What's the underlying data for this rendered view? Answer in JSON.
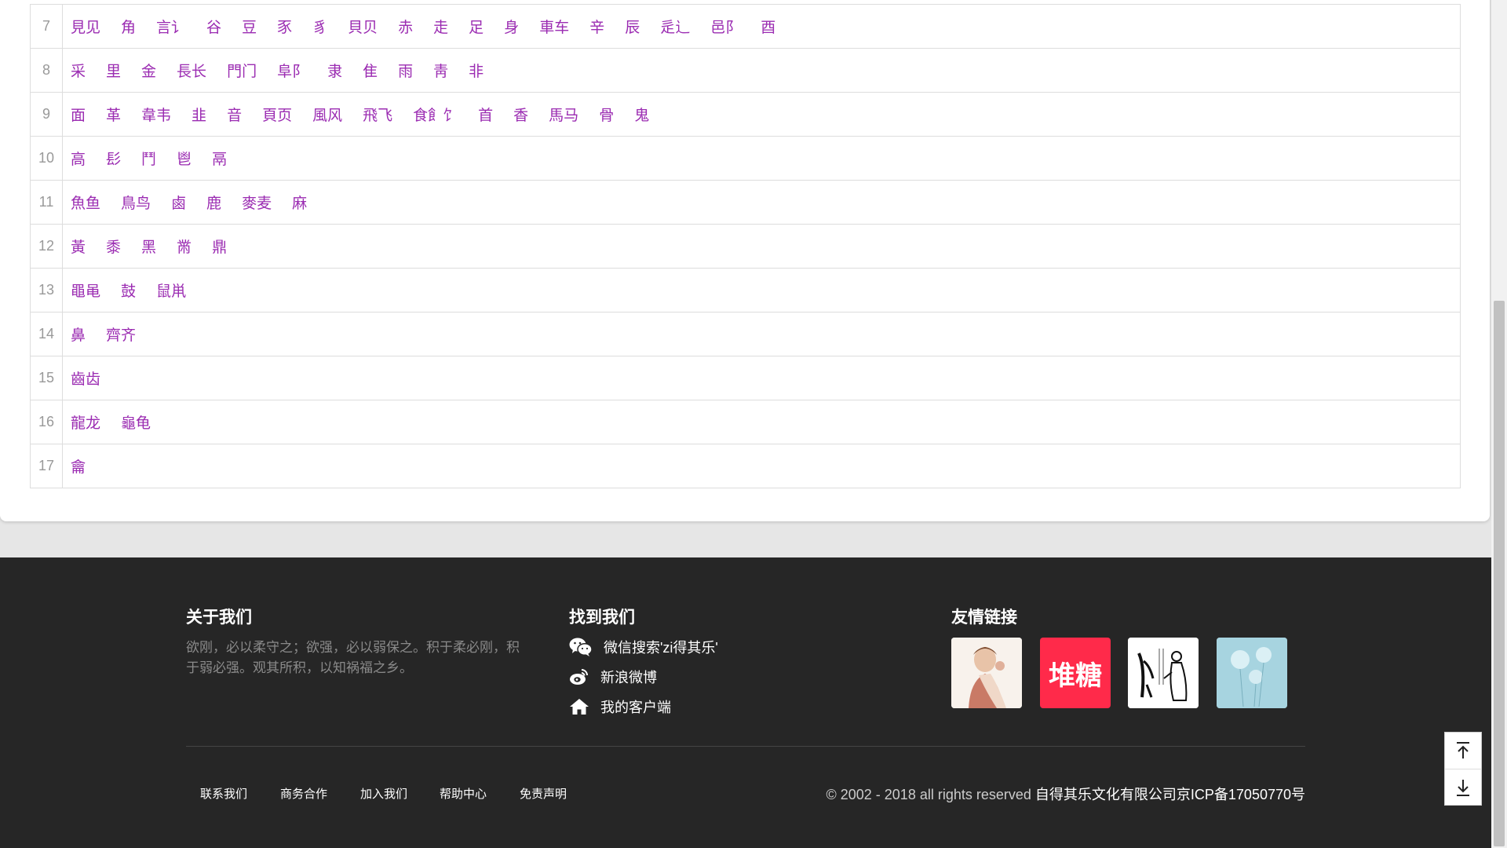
{
  "radicals": [
    {
      "strokes": "7",
      "chars": [
        "見见",
        "角",
        "言讠",
        "谷",
        "豆",
        "豕",
        "豸",
        "貝贝",
        "赤",
        "走",
        "足",
        "身",
        "車车",
        "辛",
        "辰",
        "辵辶",
        "邑阝",
        "酉"
      ]
    },
    {
      "strokes": "8",
      "chars": [
        "采",
        "里",
        "金",
        "長长",
        "門门",
        "阜阝",
        "隶",
        "隹",
        "雨",
        "靑",
        "非"
      ]
    },
    {
      "strokes": "9",
      "chars": [
        "面",
        "革",
        "韋韦",
        "韭",
        "音",
        "頁页",
        "風风",
        "飛飞",
        "食飠饣",
        "首",
        "香",
        "馬马",
        "骨",
        "鬼"
      ]
    },
    {
      "strokes": "10",
      "chars": [
        "高",
        "髟",
        "鬥",
        "鬯",
        "鬲"
      ]
    },
    {
      "strokes": "11",
      "chars": [
        "魚鱼",
        "鳥鸟",
        "鹵",
        "鹿",
        "麥麦",
        "麻"
      ]
    },
    {
      "strokes": "12",
      "chars": [
        "黃",
        "黍",
        "黑",
        "黹",
        "鼎"
      ]
    },
    {
      "strokes": "13",
      "chars": [
        "黽黾",
        "鼓",
        "鼠鼡"
      ]
    },
    {
      "strokes": "14",
      "chars": [
        "鼻",
        "齊齐"
      ]
    },
    {
      "strokes": "15",
      "chars": [
        "齒齿"
      ]
    },
    {
      "strokes": "16",
      "chars": [
        "龍龙",
        "龜龟"
      ]
    },
    {
      "strokes": "17",
      "chars": [
        "龠"
      ]
    }
  ],
  "footer": {
    "about": {
      "title": "关于我们",
      "text": "欲刚，必以柔守之；欲强，必以弱保之。积于柔必刚，积于弱必强。观其所积，以知祸福之乡。"
    },
    "find": {
      "title": "找到我们",
      "wechat": "微信搜索'zi得其乐'",
      "weibo": "新浪微博",
      "client": "我的客户端"
    },
    "links": {
      "title": "友情链接",
      "duitang": "堆糖"
    },
    "bottom_links": [
      "联系我们",
      "商务合作",
      "加入我们",
      "帮助中心",
      "免责声明"
    ],
    "copyright_prefix": "© 2002 - 2018 all rights reserved",
    "company": "自得其乐文化有限公司",
    "icp": "京ICP备17050770号"
  },
  "colors": {
    "radical_text": "#9b2cb2",
    "footer_bg": "#262626",
    "duitang_red": "#ff2a4a"
  }
}
